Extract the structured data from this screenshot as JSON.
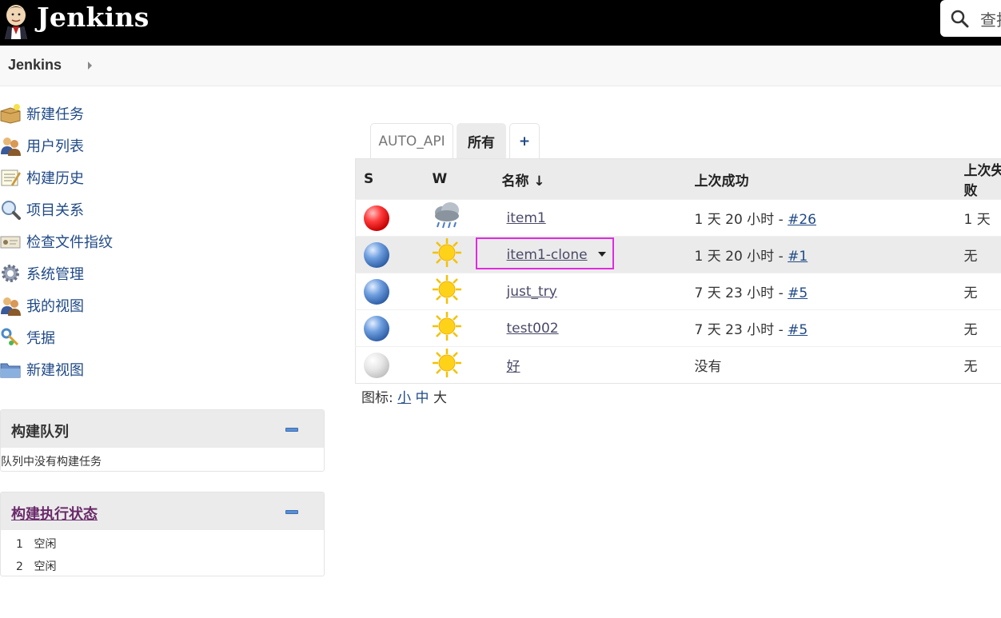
{
  "header": {
    "brand": "Jenkins",
    "search_placeholder": "查找"
  },
  "breadcrumb": {
    "root": "Jenkins"
  },
  "tasks": [
    {
      "label": "新建任务",
      "icon": "new-package-icon"
    },
    {
      "label": "用户列表",
      "icon": "users-icon"
    },
    {
      "label": "构建历史",
      "icon": "notepad-icon"
    },
    {
      "label": "项目关系",
      "icon": "magnifier-icon"
    },
    {
      "label": "检查文件指纹",
      "icon": "fingerprint-icon"
    },
    {
      "label": "系统管理",
      "icon": "gear-icon"
    },
    {
      "label": "我的视图",
      "icon": "user-icon"
    },
    {
      "label": "凭据",
      "icon": "keys-icon"
    },
    {
      "label": "新建视图",
      "icon": "folder-icon"
    }
  ],
  "queue": {
    "title": "构建队列",
    "empty": "队列中没有构建任务"
  },
  "executors": {
    "title": "构建执行状态",
    "rows": [
      {
        "num": "1",
        "status": "空闲"
      },
      {
        "num": "2",
        "status": "空闲"
      }
    ]
  },
  "tabs": {
    "auto_api": "AUTO_API",
    "all": "所有",
    "add": "+"
  },
  "table": {
    "headers": {
      "s": "S",
      "w": "W",
      "name": "名称 ↓",
      "last_success": "上次成功",
      "last_failure": "上次失败"
    },
    "rows": [
      {
        "status": "red",
        "weather": "rain",
        "name": "item1",
        "success_time": "1 天 20 小时 - ",
        "success_build": "#26",
        "failure": "1 天"
      },
      {
        "status": "blue",
        "weather": "sun",
        "name": "item1-clone",
        "success_time": "1 天 20 小时 - ",
        "success_build": "#1",
        "failure": "无"
      },
      {
        "status": "blue",
        "weather": "sun",
        "name": "just_try",
        "success_time": "7 天 23 小时 - ",
        "success_build": "#5",
        "failure": "无"
      },
      {
        "status": "blue",
        "weather": "sun",
        "name": "test002",
        "success_time": "7 天 23 小时 - ",
        "success_build": "#5",
        "failure": "无"
      },
      {
        "status": "grey",
        "weather": "sun",
        "name": "好",
        "success_time": "没有",
        "success_build": "",
        "failure": "无"
      }
    ]
  },
  "legend": {
    "label": "图标: ",
    "small": "小",
    "medium": "中",
    "large": "大"
  }
}
